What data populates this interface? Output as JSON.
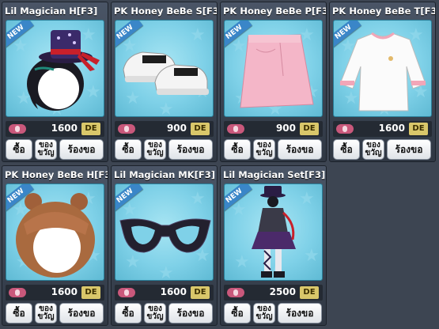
{
  "items": [
    {
      "name": "Lil Magician H[F3]",
      "price": "1600",
      "currency": "DE",
      "new": true,
      "art": "magician-hat-hair",
      "buy": "ซื้อ",
      "gift": "ของขวัญ",
      "request": "ร้องขอ"
    },
    {
      "name": "PK Honey BeBe S[F3]",
      "price": "900",
      "currency": "DE",
      "new": true,
      "art": "white-sneakers",
      "buy": "ซื้อ",
      "gift": "ของขวัญ",
      "request": "ร้องขอ"
    },
    {
      "name": "PK Honey BeBe P[F3]",
      "price": "900",
      "currency": "DE",
      "new": true,
      "art": "pink-skirt",
      "buy": "ซื้อ",
      "gift": "ของขวัญ",
      "request": "ร้องขอ"
    },
    {
      "name": "PK Honey BeBe T[F3]",
      "price": "1600",
      "currency": "DE",
      "new": true,
      "art": "white-shirt",
      "buy": "ซื้อ",
      "gift": "ของขวัญ",
      "request": "ร้องขอ"
    },
    {
      "name": "PK Honey BeBe H[F3]",
      "price": "1600",
      "currency": "DE",
      "new": true,
      "art": "brown-hair",
      "buy": "ซื้อ",
      "gift": "ของขวัญ",
      "request": "ร้องขอ"
    },
    {
      "name": "Lil Magician MK[F3]",
      "price": "1600",
      "currency": "DE",
      "new": true,
      "art": "black-mask",
      "buy": "ซื้อ",
      "gift": "ของขวัญ",
      "request": "ร้องขอ"
    },
    {
      "name": "Lil Magician Set[F3]",
      "price": "2500",
      "currency": "DE",
      "new": true,
      "art": "magician-outfit-set",
      "buy": "ซื้อ",
      "gift": "ของขวัญ",
      "request": "ร้องขอ"
    }
  ],
  "badge_text": "NEW",
  "colors": {
    "background": "#3d4552",
    "preview": "#7fd1e8",
    "new_badge": "#3a86c8",
    "currency_tag": "#d9c76a"
  }
}
